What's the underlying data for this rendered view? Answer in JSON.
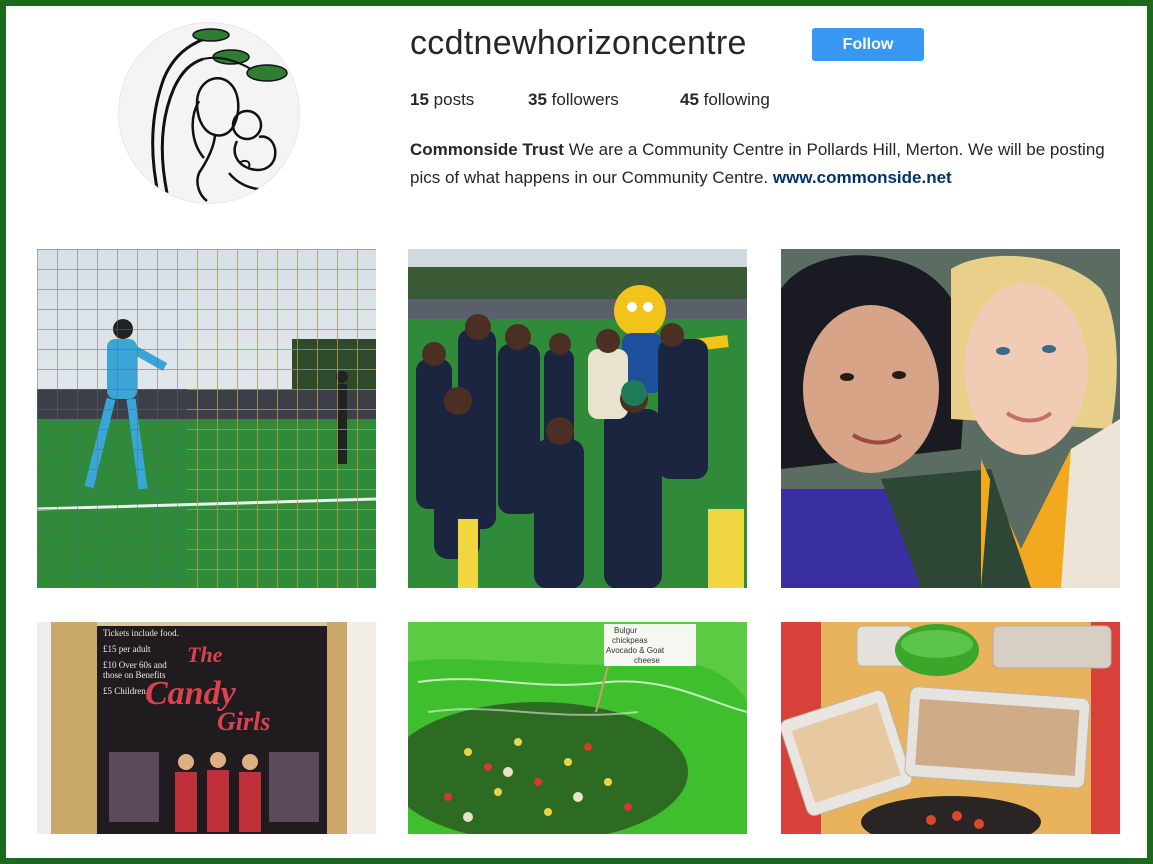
{
  "profile": {
    "username": "ccdtnewhorizoncentre",
    "follow_label": "Follow",
    "stats": {
      "posts_count": "15",
      "posts_label": "posts",
      "followers_count": "35",
      "followers_label": "followers",
      "following_count": "45",
      "following_label": "following"
    },
    "bio": {
      "name": "Commonside Trust",
      "text": "We are a Community Centre in Pollards Hill, Merton. We will be posting pics of what happens in our Community Centre.",
      "link": "www.commonside.net"
    }
  },
  "posts": {
    "poster": {
      "ticket_lines": [
        "Tickets include food.",
        "£15 per adult",
        "£10 Over 60s and",
        "those on Benefits",
        "£5 Children"
      ],
      "title_line1": "The",
      "title_line2": "Candy",
      "title_line3": "Girls"
    },
    "salad": {
      "label_lines": [
        "Bulgur",
        "chickpeas",
        "Avocado & Goat",
        "cheese"
      ]
    }
  },
  "colors": {
    "page_border": "#1b6a1e",
    "follow_button": "#3897f0",
    "link": "#003569"
  }
}
